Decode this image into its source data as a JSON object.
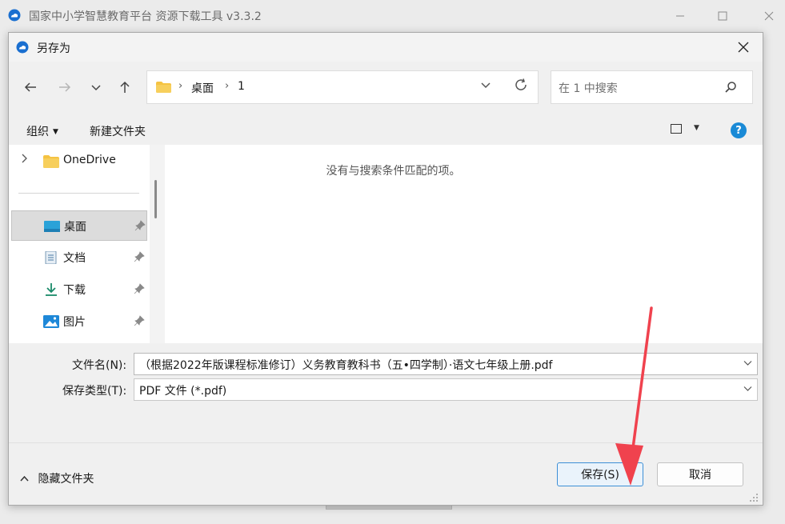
{
  "app": {
    "title": "国家中小学智慧教育平台 资源下载工具 v3.3.2",
    "logo_icon": "cloud-logo-icon",
    "controls": [
      "minimize-icon",
      "maximize-icon",
      "close-icon"
    ]
  },
  "dialog": {
    "title": "另存为",
    "close_icon": "close-icon",
    "nav": {
      "back_icon": "arrow-left-icon",
      "forward_icon": "arrow-right-icon",
      "recent_icon": "chevron-down-icon",
      "up_icon": "arrow-up-icon"
    },
    "address": {
      "parts": [
        "桌面",
        "1"
      ],
      "separator": "›"
    },
    "search": {
      "placeholder": "在 1 中搜索"
    },
    "toolbar": {
      "organize": "组织",
      "new_folder": "新建文件夹",
      "help": "?"
    },
    "tree": {
      "onedrive": "OneDrive",
      "desktop": "桌面",
      "documents": "文档",
      "downloads": "下载",
      "pictures": "图片",
      "selected": "桌面"
    },
    "content": {
      "empty_message": "没有与搜索条件匹配的项。"
    },
    "filename": {
      "label": "文件名(N):",
      "value": "（根据2022年版课程标准修订）义务教育教科书（五•四学制）·语文七年级上册.pdf"
    },
    "filetype": {
      "label": "保存类型(T):",
      "value": "PDF 文件 (*.pdf)"
    },
    "footer": {
      "hide_folders": "隐藏文件夹",
      "save": "保存(S)",
      "cancel": "取消"
    }
  },
  "colors": {
    "accent": "#1a8ad6",
    "save_border": "#3d8fd6",
    "annotation": "#f0424e",
    "folder": "#f5c342"
  }
}
